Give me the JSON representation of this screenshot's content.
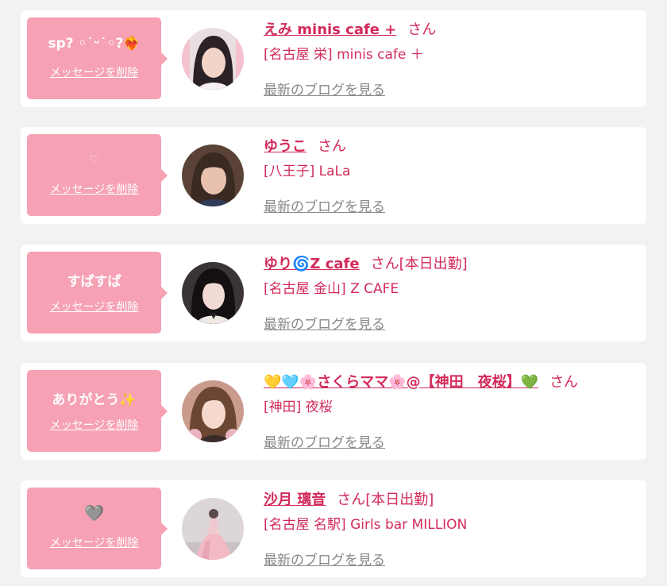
{
  "delete_label": "メッセージを削除",
  "blog_label": "最新のブログを見る",
  "honorific": "さん",
  "colors": {
    "accent": "#d22b5a",
    "bubble": "#f6a1b4",
    "background": "#f2f2f2",
    "link_gray": "#888888"
  },
  "messages": [
    {
      "message": "sp? ◦˙ᵕ˙◦?❤️‍🔥",
      "name": "えみ minis cafe +",
      "status": "",
      "shop": "[名古屋 栄] minis cafe ＋",
      "avatar_icon": "profile-photo-icon"
    },
    {
      "message": "♡",
      "name": "ゆうこ",
      "status": "",
      "shop": "[八王子] LaLa",
      "avatar_icon": "profile-photo-icon"
    },
    {
      "message": "すぱすぱ",
      "name": "ゆり🌀Z cafe",
      "status": "[本日出勤]",
      "shop": "[名古屋 金山] Z CAFE",
      "avatar_icon": "profile-photo-icon"
    },
    {
      "message": "ありがとう✨",
      "name": "💛🩵🌸さくらママ🌸@【神田　夜桜】💚",
      "status": "",
      "shop": "[神田] 夜桜",
      "avatar_icon": "profile-photo-icon"
    },
    {
      "message": "🩶",
      "name": "沙月 璃音",
      "status": "[本日出勤]",
      "shop": "[名古屋 名駅] Girls bar MILLION",
      "avatar_icon": "profile-photo-icon"
    }
  ]
}
